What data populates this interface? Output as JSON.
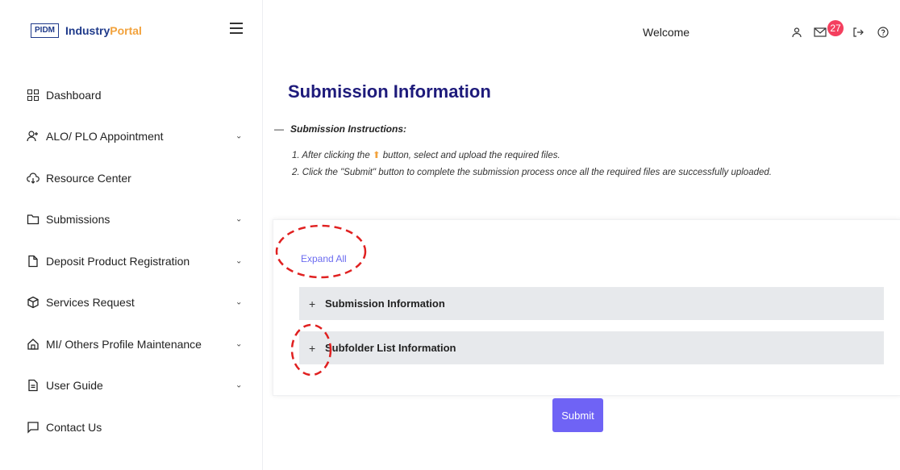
{
  "brand": {
    "logo_box": "PIDM",
    "name_primary": "Industry",
    "name_accent": "Portal"
  },
  "header": {
    "welcome": "Welcome",
    "notification_count": "27"
  },
  "sidebar": {
    "items": [
      {
        "label": "Dashboard",
        "icon": "dashboard-icon",
        "has_chevron": false
      },
      {
        "label": "ALO/ PLO Appointment",
        "icon": "user-add-icon",
        "has_chevron": true
      },
      {
        "label": "Resource Center",
        "icon": "cloud-download-icon",
        "has_chevron": false
      },
      {
        "label": "Submissions",
        "icon": "folder-icon",
        "has_chevron": true
      },
      {
        "label": "Deposit Product Registration",
        "icon": "file-icon",
        "has_chevron": true
      },
      {
        "label": "Services Request",
        "icon": "box-icon",
        "has_chevron": true
      },
      {
        "label": "MI/ Others Profile Maintenance",
        "icon": "home-icon",
        "has_chevron": true
      },
      {
        "label": "User Guide",
        "icon": "document-icon",
        "has_chevron": true
      },
      {
        "label": "Contact Us",
        "icon": "message-icon",
        "has_chevron": false
      }
    ]
  },
  "main": {
    "title": "Submission Information",
    "instructions_heading": "Submission Instructions:",
    "instruction_1_pre": "1. After clicking the",
    "instruction_1_post": "button, select and upload the required files.",
    "instruction_2": "2. Click the \"Submit\" button to complete the submission process once all the required files are successfully uploaded.",
    "expand_all": "Expand All",
    "panels": [
      {
        "label": "Submission Information"
      },
      {
        "label": "Subfolder List Information"
      }
    ],
    "submit_label": "Submit"
  },
  "colors": {
    "title": "#1e1b7b",
    "accent": "#6f63f5",
    "badge": "#f43f5e",
    "annotation": "#e02020"
  }
}
